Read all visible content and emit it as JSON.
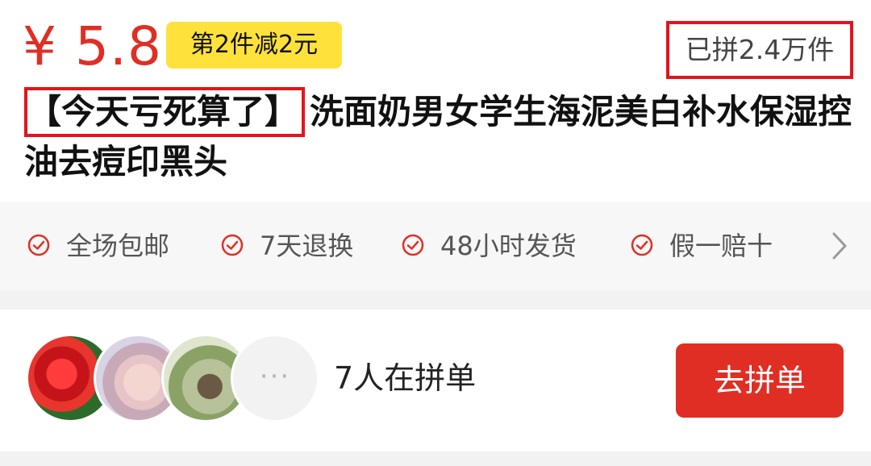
{
  "product": {
    "price": "¥ 5.8",
    "promo_badge": "第2件减2元",
    "sold_count": "已拼2.4万件",
    "title_highlight": "【今天亏死算了】",
    "title_rest": "洗面奶男女学生海泥美白补水保湿控油去痘印黑头"
  },
  "services": {
    "items": [
      {
        "label": "全场包邮",
        "icon": "check-circle-icon"
      },
      {
        "label": "7天退换",
        "icon": "check-circle-icon"
      },
      {
        "label": "48小时发货",
        "icon": "check-circle-icon"
      },
      {
        "label": "假一赔十",
        "icon": "check-circle-icon"
      }
    ],
    "more_icon": "chevron-right-icon"
  },
  "group_buy": {
    "avatars": [
      "avatar-rose",
      "avatar-girl",
      "avatar-person-trees"
    ],
    "more_text": "···",
    "count_text": "7人在拼单",
    "button_label": "去拼单"
  },
  "colors": {
    "accent_red": "#e02e24",
    "badge_yellow": "#ffe13b",
    "highlight_border": "#e5131b"
  }
}
